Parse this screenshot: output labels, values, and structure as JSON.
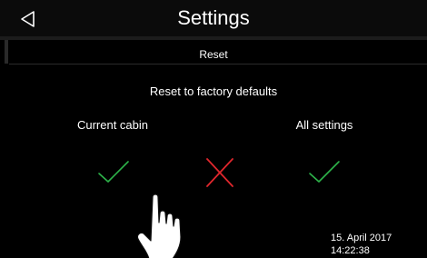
{
  "header": {
    "title": "Settings",
    "back_icon": "back-triangle-icon"
  },
  "section": {
    "title": "Reset"
  },
  "dialog": {
    "question": "Reset to factory defaults",
    "options": [
      {
        "label": "Current cabin",
        "icon": "check-icon",
        "color": "#2db34a"
      },
      {
        "label": "All settings",
        "icon": "check-icon",
        "color": "#2db34a"
      }
    ],
    "cancel": {
      "icon": "close-x-icon",
      "color": "#e0272d"
    }
  },
  "status": {
    "date": "15. April 2017",
    "time": "14:22:38"
  },
  "overlay": {
    "icon": "pointing-hand-icon"
  }
}
